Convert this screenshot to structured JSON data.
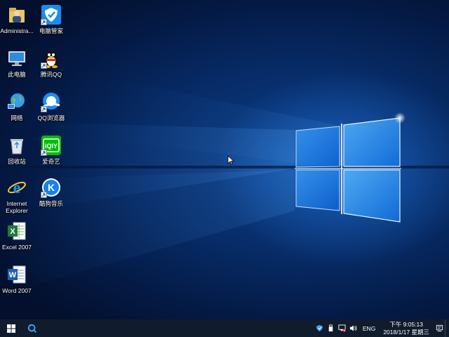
{
  "desktop": {
    "icons": [
      {
        "name": "administrator-folder",
        "label": "Administra..."
      },
      {
        "name": "pc-manager",
        "label": "电脑管家"
      },
      {
        "name": "this-pc",
        "label": "此电脑"
      },
      {
        "name": "tencent-qq",
        "label": "腾讯QQ"
      },
      {
        "name": "network",
        "label": "网络"
      },
      {
        "name": "qq-browser",
        "label": "QQ浏览器"
      },
      {
        "name": "recycle-bin",
        "label": "回收站"
      },
      {
        "name": "iqiyi",
        "label": "爱奇艺"
      },
      {
        "name": "internet-explorer",
        "label": "Internet Explorer"
      },
      {
        "name": "kugou-music",
        "label": "酷狗音乐"
      },
      {
        "name": "excel-2007",
        "label": "Excel 2007"
      },
      {
        "name": "word-2007",
        "label": "Word 2007"
      }
    ]
  },
  "taskbar": {
    "tray": {
      "language": "ENG",
      "time": "下午 9:05:13",
      "date": "2018/1/17 星期三"
    }
  },
  "colors": {
    "taskbar": "#101b2b",
    "accent_blue": "#1e90ff",
    "wallpaper_dark": "#041a45"
  }
}
